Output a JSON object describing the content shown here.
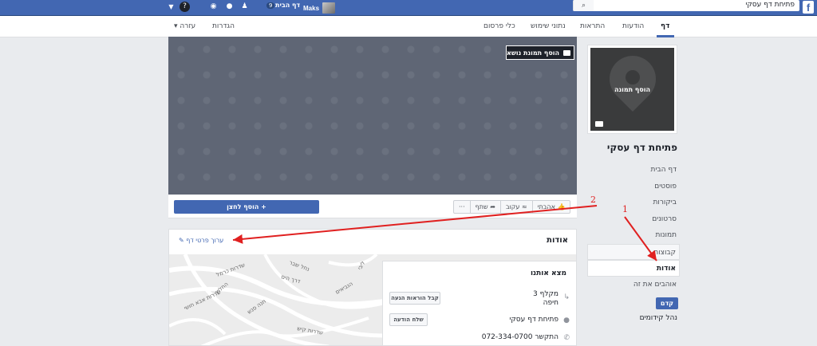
{
  "topbar": {
    "logo": "f",
    "search_value": "פתיחת דף עסקי",
    "search_icon": "search-icon",
    "user_name": "Maks",
    "home_label": "דף הבית",
    "home_count": "9",
    "icons": [
      "friends-icon",
      "messenger-icon",
      "globe-icon",
      "help-icon",
      "dropdown-icon"
    ]
  },
  "pagenav": {
    "tabs": [
      "דף",
      "הודעות",
      "התראות",
      "נתוני שימוש",
      "כלי פרסום"
    ],
    "right_tabs": [
      "הגדרות",
      "עזרה"
    ]
  },
  "sidebar": {
    "add_photo": "הוסף תמונה",
    "page_name": "פתיחת דף עסקי",
    "items": [
      "דף הבית",
      "פוסטים",
      "ביקורות",
      "סרטונים",
      "תמונות",
      "קבוצות",
      "אודות",
      "אוהבים את זה"
    ],
    "promote": "קדם",
    "manage_promotions": "נהל קידומים"
  },
  "cover": {
    "add_cover": "הוסף תמונת נושא"
  },
  "actions": {
    "add_button": "+ הוסף לחצן",
    "liked": "אהבתי",
    "follow": "עקוב",
    "share": "שתף",
    "more": "···"
  },
  "about": {
    "title": "אודות",
    "edit_details": "ערוך פרטי דף",
    "find_us": "מצא אותנו",
    "address_line1": "מקלף 3",
    "address_line2": "חיפה",
    "get_directions": "קבל הוראות הגעה",
    "messenger_name": "פתיחת דף עסקי",
    "send_message": "שלח הודעה",
    "phone": "התקשר 072-334-0700"
  },
  "map_labels": [
    "שדרות כרמל",
    "שדרות אבא חושי",
    "דרך הים",
    "הנביאים",
    "שדרות קיש",
    "החלוץ",
    "נחל שבר",
    "חנה סנש",
    "ליבי"
  ],
  "annotations": {
    "one": "1",
    "two": "2",
    "color": "#e02020"
  }
}
